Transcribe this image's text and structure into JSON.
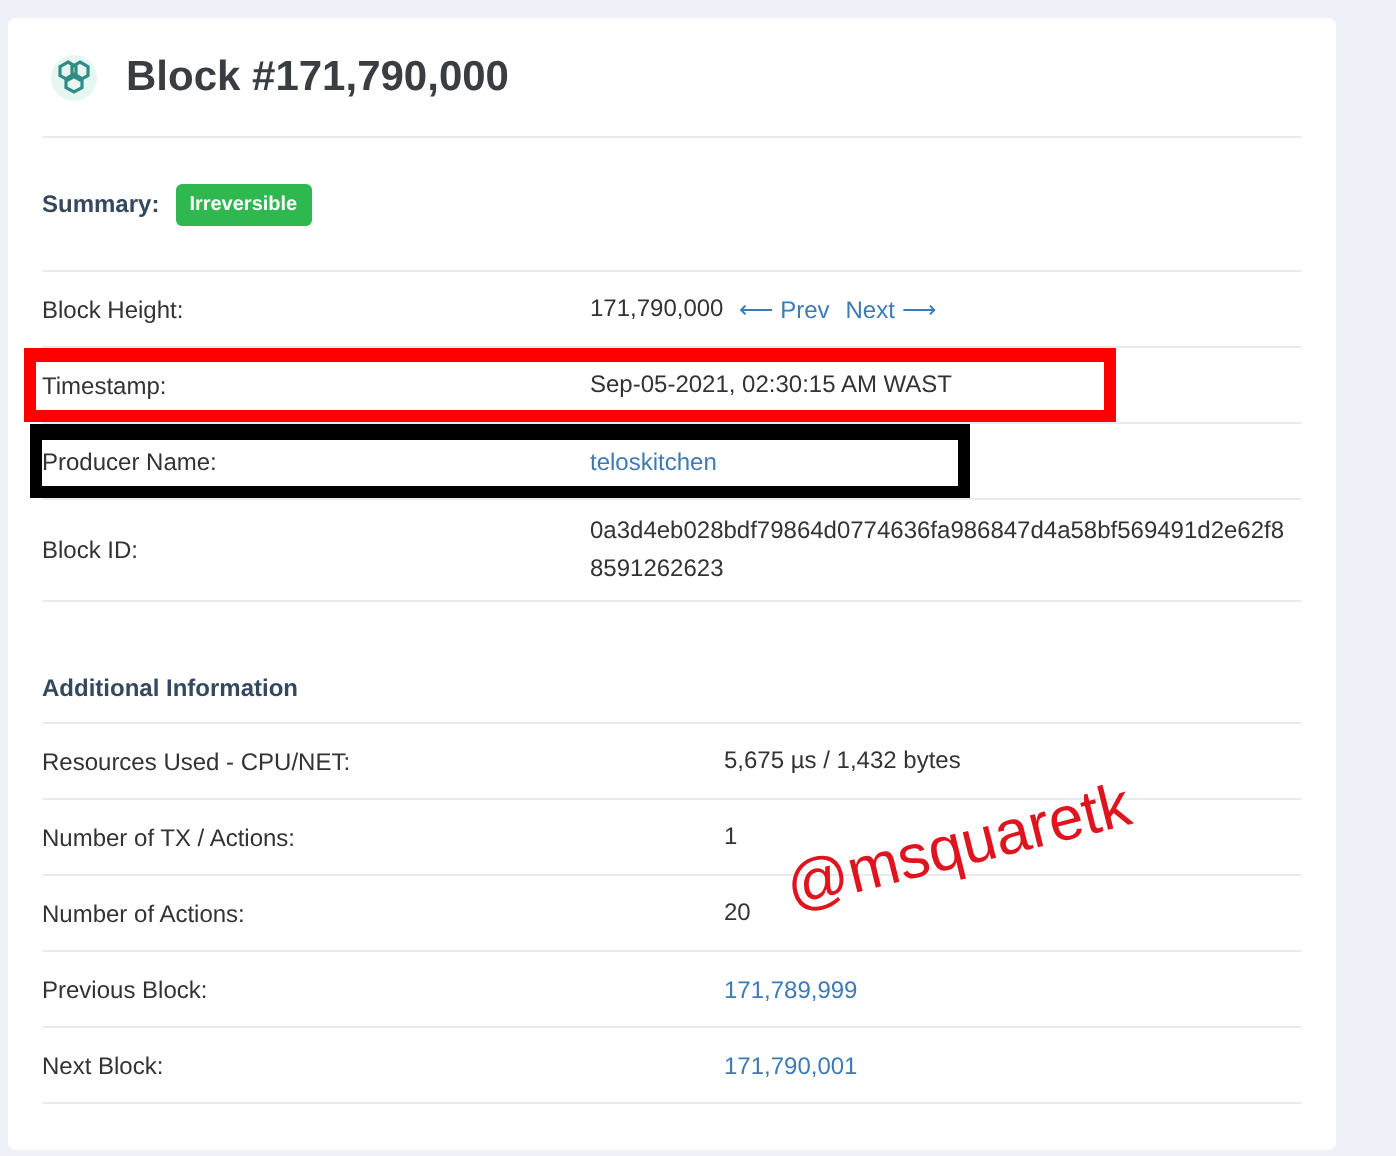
{
  "title": "Block #171,790,000",
  "summary": {
    "label": "Summary:",
    "badge": "Irreversible"
  },
  "rows": [
    {
      "kind": "nav",
      "label": "Block Height:",
      "value": "171,790,000",
      "prev": "⟵ Prev",
      "next": "Next ⟶"
    },
    {
      "kind": "text",
      "label": "Timestamp:",
      "value": "Sep-05-2021, 02:30:15 AM WAST",
      "color": "#ff0000"
    },
    {
      "kind": "link",
      "label": "Producer Name:",
      "value": "teloskitchen",
      "color": "#000000"
    },
    {
      "kind": "text",
      "label": "Block ID:",
      "value": "0a3d4eb028bdf79864d0774636fa986847d4a58bf569491d2e62f88591262623"
    }
  ],
  "additional": {
    "heading": "Additional Information",
    "rows": [
      {
        "kind": "text",
        "label": "Resources Used - CPU/NET:",
        "value": "5,675 µs / 1,432 bytes"
      },
      {
        "kind": "text",
        "label": "Number of TX / Actions:",
        "value": "1"
      },
      {
        "kind": "text",
        "label": "Number of Actions:",
        "value": "20"
      },
      {
        "kind": "link",
        "label": "Previous Block:",
        "value": "171,789,999"
      },
      {
        "kind": "link",
        "label": "Next Block:",
        "value": "171,790,001"
      }
    ]
  },
  "annotation": "@msquaretk"
}
